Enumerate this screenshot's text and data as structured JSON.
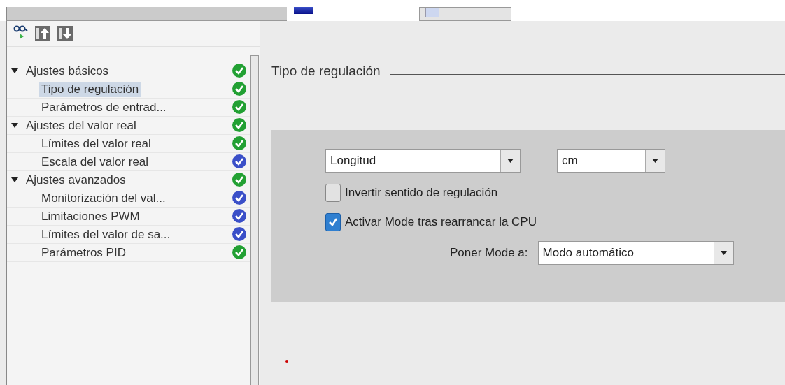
{
  "tree": [
    {
      "label": "Ajustes básicos",
      "expanded": true,
      "selected": false,
      "color": "#22a033",
      "children": [
        {
          "label": "Tipo de regulación",
          "selected": true,
          "color": "#22a033"
        },
        {
          "label": "Parámetros de entrad...",
          "selected": false,
          "color": "#22a033"
        }
      ]
    },
    {
      "label": "Ajustes del valor real",
      "expanded": true,
      "selected": false,
      "color": "#22a033",
      "children": [
        {
          "label": "Límites del valor real",
          "selected": false,
          "color": "#22a033"
        },
        {
          "label": "Escala del valor real",
          "selected": false,
          "color": "#3a4fc8"
        }
      ]
    },
    {
      "label": "Ajustes avanzados",
      "expanded": true,
      "selected": false,
      "color": "#22a033",
      "children": [
        {
          "label": "Monitorización del val...",
          "selected": false,
          "color": "#3a4fc8"
        },
        {
          "label": "Limitaciones PWM",
          "selected": false,
          "color": "#3a4fc8"
        },
        {
          "label": "Límites del valor de sa...",
          "selected": false,
          "color": "#3a4fc8"
        },
        {
          "label": "Parámetros PID",
          "selected": false,
          "color": "#22a033"
        }
      ]
    }
  ],
  "section": {
    "title": "Tipo de regulación",
    "dropdowns": [
      {
        "value": "Longitud"
      },
      {
        "value": "cm"
      }
    ],
    "checkboxes": [
      {
        "label": "Invertir sentido de regulación",
        "checked": false
      },
      {
        "label": "Activar Mode tras rearrancar la CPU",
        "checked": true
      }
    ],
    "mode": {
      "label": "Poner Mode a:",
      "value": "Modo automático"
    }
  }
}
